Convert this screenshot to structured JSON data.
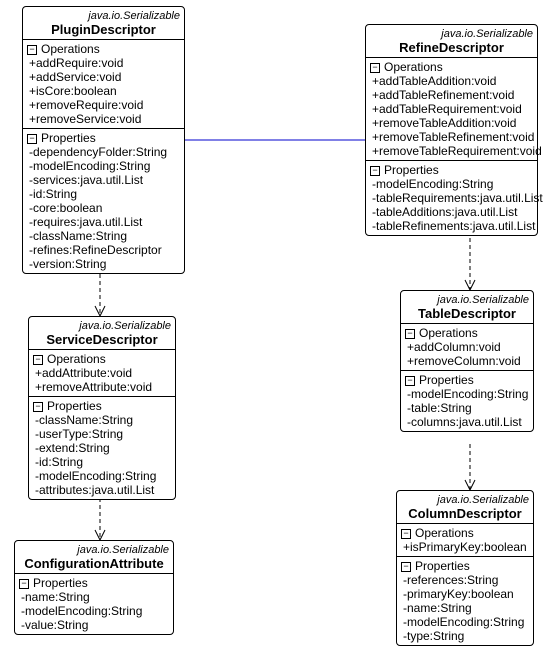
{
  "classes": {
    "pluginDescriptor": {
      "stereotype": "java.io.Serializable",
      "name": "PluginDescriptor",
      "opsHeader": "Operations",
      "ops": [
        "+addRequire:void",
        "+addService:void",
        "+isCore:boolean",
        "+removeRequire:void",
        "+removeService:void"
      ],
      "propsHeader": "Properties",
      "props": [
        "-dependencyFolder:String",
        "-modelEncoding:String",
        "-services:java.util.List",
        "-id:String",
        "-core:boolean",
        "-requires:java.util.List",
        "-className:String",
        "-refines:RefineDescriptor",
        "-version:String"
      ]
    },
    "refineDescriptor": {
      "stereotype": "java.io.Serializable",
      "name": "RefineDescriptor",
      "opsHeader": "Operations",
      "ops": [
        "+addTableAddition:void",
        "+addTableRefinement:void",
        "+addTableRequirement:void",
        "+removeTableAddition:void",
        "+removeTableRefinement:void",
        "+removeTableRequirement:void"
      ],
      "propsHeader": "Properties",
      "props": [
        "-modelEncoding:String",
        "-tableRequirements:java.util.List",
        "-tableAdditions:java.util.List",
        "-tableRefinements:java.util.List"
      ]
    },
    "serviceDescriptor": {
      "stereotype": "java.io.Serializable",
      "name": "ServiceDescriptor",
      "opsHeader": "Operations",
      "ops": [
        "+addAttribute:void",
        "+removeAttribute:void"
      ],
      "propsHeader": "Properties",
      "props": [
        "-className:String",
        "-userType:String",
        "-extend:String",
        "-id:String",
        "-modelEncoding:String",
        "-attributes:java.util.List"
      ]
    },
    "configurationAttribute": {
      "stereotype": "java.io.Serializable",
      "name": "ConfigurationAttribute",
      "propsHeader": "Properties",
      "props": [
        "-name:String",
        "-modelEncoding:String",
        "-value:String"
      ]
    },
    "tableDescriptor": {
      "stereotype": "java.io.Serializable",
      "name": "TableDescriptor",
      "opsHeader": "Operations",
      "ops": [
        "+addColumn:void",
        "+removeColumn:void"
      ],
      "propsHeader": "Properties",
      "props": [
        "-modelEncoding:String",
        "-table:String",
        "-columns:java.util.List"
      ]
    },
    "columnDescriptor": {
      "stereotype": "java.io.Serializable",
      "name": "ColumnDescriptor",
      "opsHeader": "Operations",
      "ops": [
        "+isPrimaryKey:boolean"
      ],
      "propsHeader": "Properties",
      "props": [
        "-references:String",
        "-primaryKey:boolean",
        "-name:String",
        "-modelEncoding:String",
        "-type:String"
      ]
    }
  },
  "toggle": "−"
}
